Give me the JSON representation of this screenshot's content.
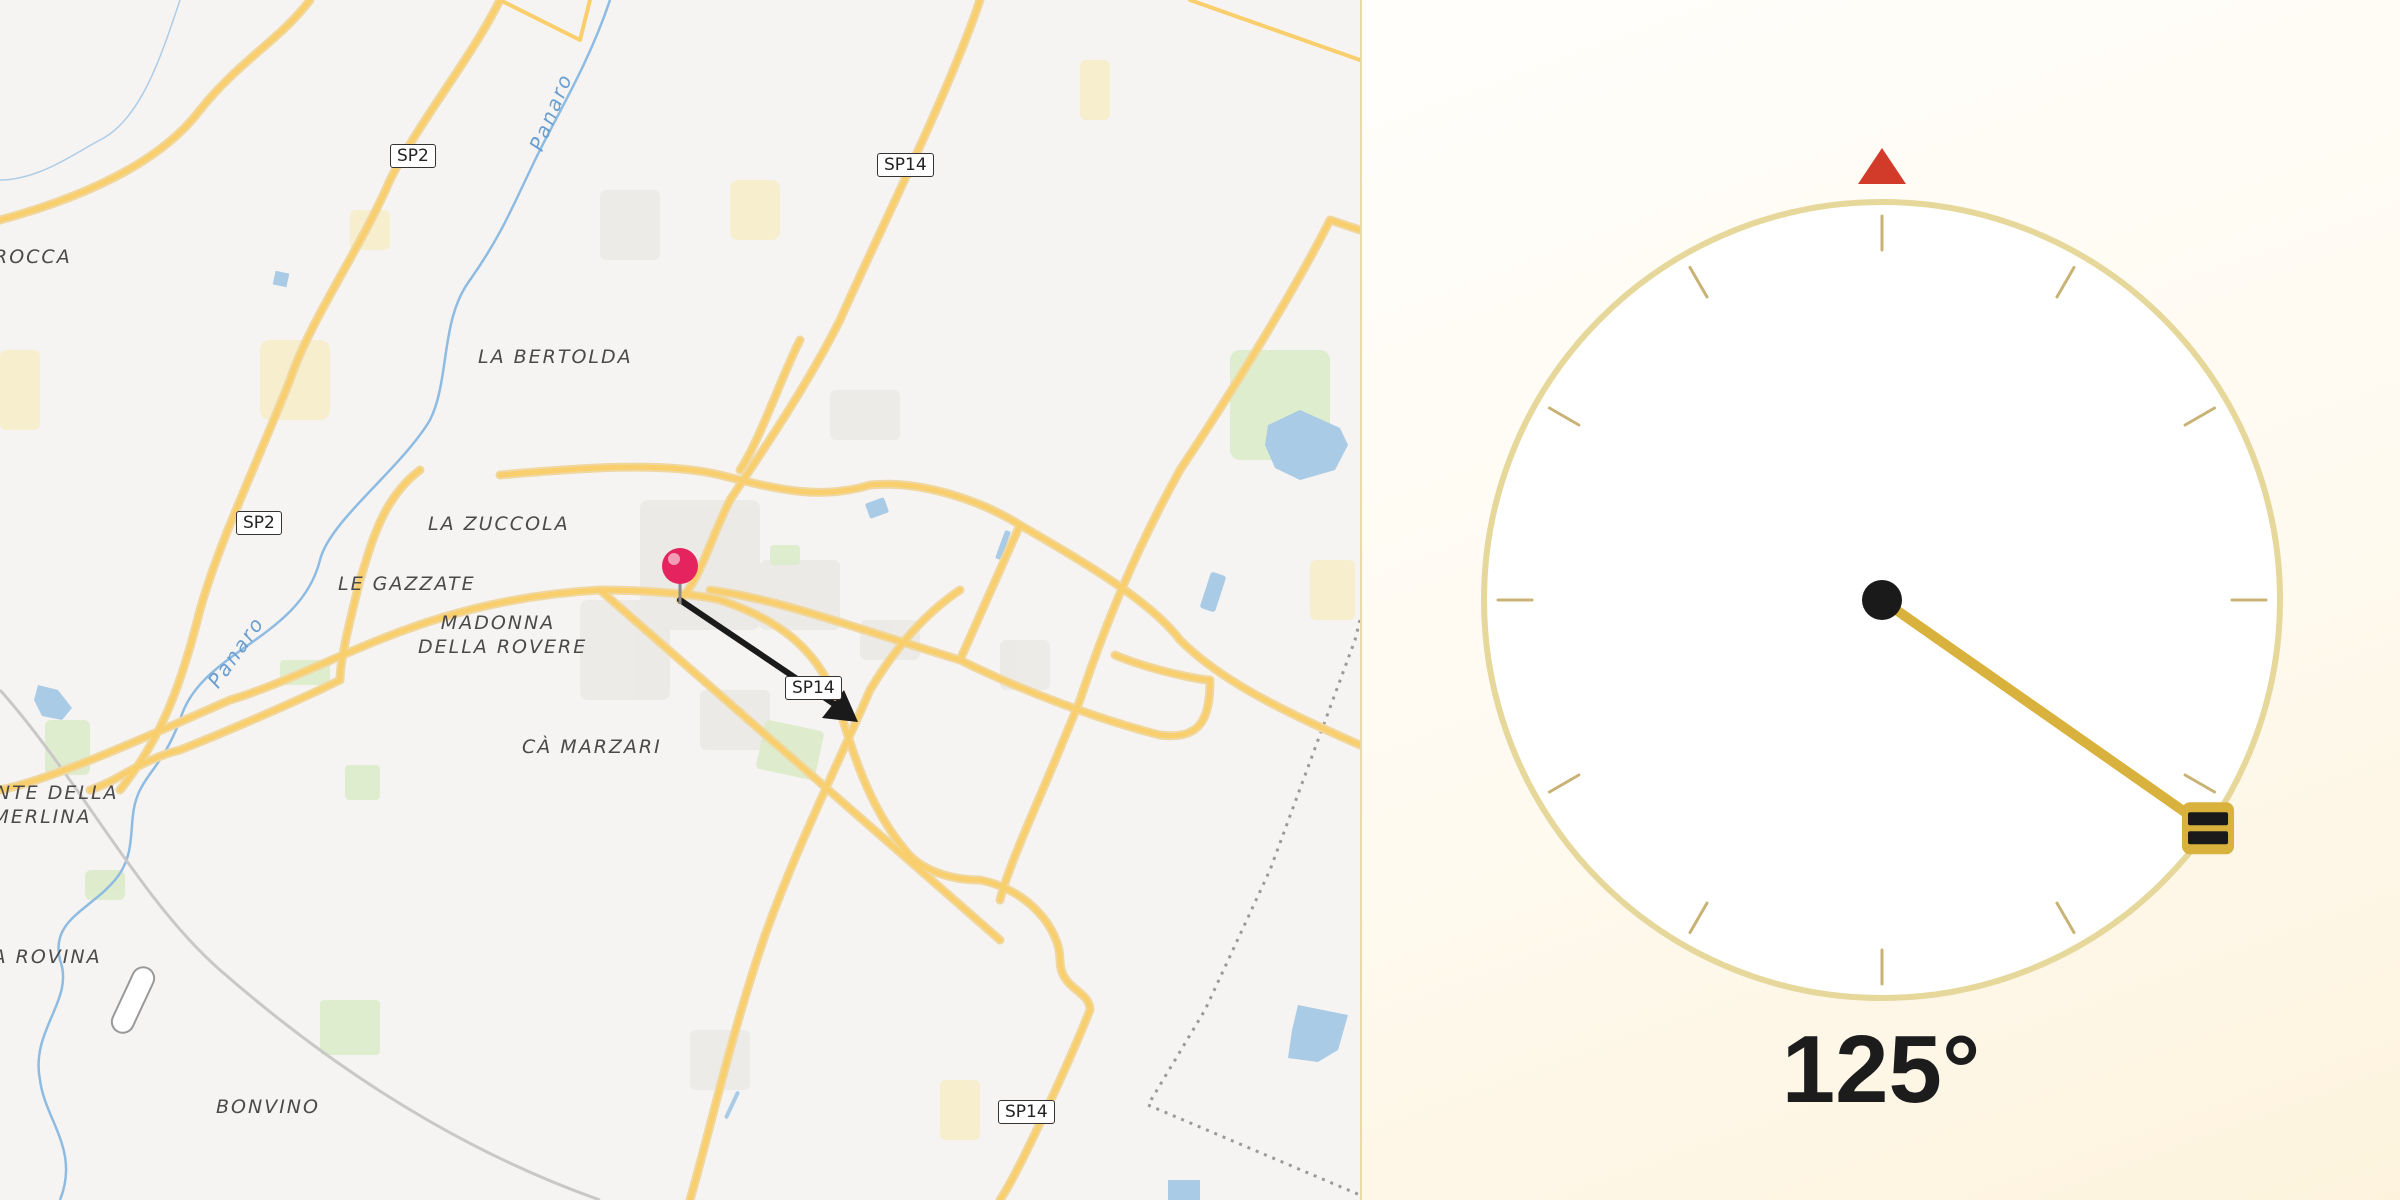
{
  "map": {
    "places": {
      "rocca": "ROCCA",
      "la_bertolda": "LA BERTOLDA",
      "la_zuccola": "LA ZUCCOLA",
      "le_gazzate": "LE GAZZATE",
      "madonna_line1": "MADONNA",
      "madonna_line2": "DELLA ROVERE",
      "ca_marzari": "CÀ MARZARI",
      "ponte_line1": "PONTE DELLA",
      "ponte_line2": "MERLINA",
      "la_rovina": "LA ROVINA",
      "bonvino": "BONVINO"
    },
    "rivers": {
      "upper": "Panaro",
      "lower": "Panaro"
    },
    "road_shields": {
      "sp2_top": "SP2",
      "sp2_mid": "SP2",
      "sp14_top": "SP14",
      "sp14_mid": "SP14",
      "sp14_bottom": "SP14"
    },
    "pin_color": "#e5235f",
    "road_color": "#f6c85f",
    "water_color": "#a9cbe6"
  },
  "compass": {
    "heading_degrees": 125,
    "heading_label": "125°",
    "north_marker_color": "#d23a2a",
    "needle_color": "#d8b23c",
    "ring_color": "#e6d79a"
  }
}
